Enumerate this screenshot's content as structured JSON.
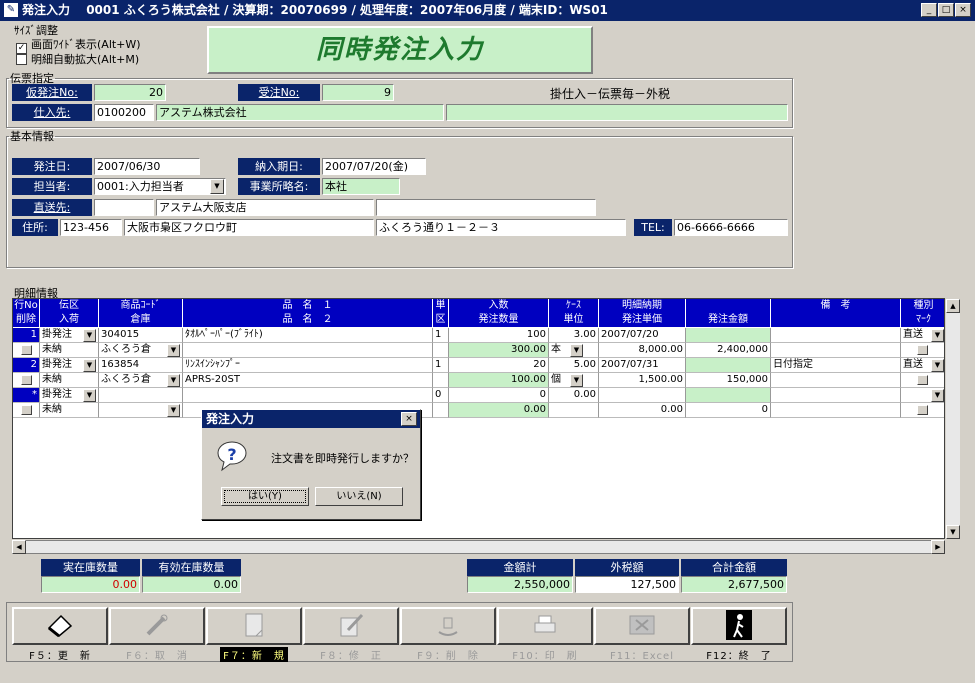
{
  "window": {
    "app_name": "発注入力",
    "info": "0001 ふくろう株式会社 / 決算期：20070699 / 処理年度：2007年06月度 / 端末ID：WS01",
    "min": "_",
    "max": "□",
    "close": "×"
  },
  "size_adjust": {
    "legend": "ｻｲｽﾞ調整",
    "opt1": "画面ﾜｲﾄﾞ表示(Alt+W)",
    "opt2": "明細自動拡大(Alt+M)",
    "opt1_checked": true,
    "opt2_checked": false
  },
  "banner": "同時発注入力",
  "slip": {
    "legend": "伝票指定",
    "temp_label": "仮発注No:",
    "temp_value": "20",
    "order_label": "受注No:",
    "order_value": "9",
    "note": "掛仕入－伝票毎－外税",
    "supplier_label": "仕入先:",
    "supplier_code": "0100200",
    "supplier_name": "アステム株式会社",
    "extra": ""
  },
  "basic": {
    "legend": "基本情報",
    "order_date_label": "発注日:",
    "order_date": "2007/06/30",
    "delivery_label": "納入期日:",
    "delivery_date": "2007/07/20(金)",
    "person_label": "担当者:",
    "person": "0001:入力担当者",
    "office_label": "事業所略名:",
    "office": "本社",
    "direct_label": "直送先:",
    "direct_code": "",
    "direct_name": "アステム大阪支店",
    "direct_extra": "",
    "address_label": "住所:",
    "zip": "123-456",
    "address1": "大阪市梟区フクロウ町",
    "address2": "ふくろう通り１－２－３",
    "tel_label": "TEL:",
    "tel": "06-6666-6666"
  },
  "detail": {
    "legend": "明細情報",
    "header1": [
      "行No",
      "伝区",
      "商品ｺｰﾄﾞ",
      "品　名　１",
      "単",
      "入数",
      "ｹｰｽ",
      "明細納期",
      "",
      "備　考",
      "種別"
    ],
    "header2": [
      "削除",
      "入荷",
      "倉庫",
      "品　名　２",
      "区",
      "発注数量",
      "単位",
      "発注単価",
      "発注金額",
      "",
      "ﾏｰｸ"
    ],
    "rows": [
      {
        "no": "1",
        "kubun": "掛発注",
        "code": "304015",
        "name1": "ﾀｵﾙﾍﾟｰﾊﾟｰ(ﾌﾞﾗｲﾄ)",
        "tani": "1",
        "irisu": "100",
        "case": "3.00",
        "nouki": "2007/07/20",
        "biko": "",
        "shubetsu": "直送",
        "nyuka": "未納",
        "soko": "ふくろう倉",
        "name2": "",
        "qty": "300.00",
        "unit": "本",
        "price": "8,000.00",
        "amount": "2,400,000"
      },
      {
        "no": "2",
        "kubun": "掛発注",
        "code": "163854",
        "name1": "ﾘﾝｽｲﾝｼｬﾝﾌﾟｰ",
        "tani": "1",
        "irisu": "20",
        "case": "5.00",
        "nouki": "2007/07/31",
        "biko": "日付指定",
        "shubetsu": "直送",
        "nyuka": "未納",
        "soko": "ふくろう倉",
        "name2": "APRS-20ST",
        "qty": "100.00",
        "unit": "個",
        "price": "1,500.00",
        "amount": "150,000"
      },
      {
        "no": "*",
        "kubun": "掛発注",
        "code": "",
        "name1": "",
        "tani": "0",
        "irisu": "0",
        "case": "0.00",
        "nouki": "",
        "biko": "",
        "shubetsu": "",
        "nyuka": "未納",
        "soko": "",
        "name2": "",
        "qty": "0.00",
        "unit": "",
        "price": "0.00",
        "amount": "0"
      }
    ]
  },
  "stock": {
    "actual_label": "実在庫数量",
    "actual": "0.00",
    "effective_label": "有効在庫数量",
    "effective": "0.00"
  },
  "totals": {
    "sum_label": "金額計",
    "sum": "2,550,000",
    "tax_label": "外税額",
    "tax": "127,500",
    "total_label": "合計金額",
    "total": "2,677,500"
  },
  "fkeys": [
    {
      "key": "F５：更　新",
      "icon": "eraser-icon",
      "enabled": true
    },
    {
      "key": "F６：取　消",
      "icon": "cancel-icon",
      "enabled": false
    },
    {
      "key": "F７：新　規",
      "icon": "new-document-icon",
      "enabled": true,
      "highlight": true
    },
    {
      "key": "F８：修　正",
      "icon": "edit-icon",
      "enabled": false
    },
    {
      "key": "F９：削　除",
      "icon": "delete-icon",
      "enabled": false
    },
    {
      "key": "F10：印　刷",
      "icon": "printer-icon",
      "enabled": false
    },
    {
      "key": "F11：Excel",
      "icon": "excel-icon",
      "enabled": false
    },
    {
      "key": "F12：終　了",
      "icon": "exit-icon",
      "enabled": true
    }
  ],
  "dialog": {
    "title": "発注入力",
    "message": "注文書を即時発行しますか？",
    "yes": "はい(Y)",
    "no": "いいえ(N)",
    "close": "×"
  }
}
